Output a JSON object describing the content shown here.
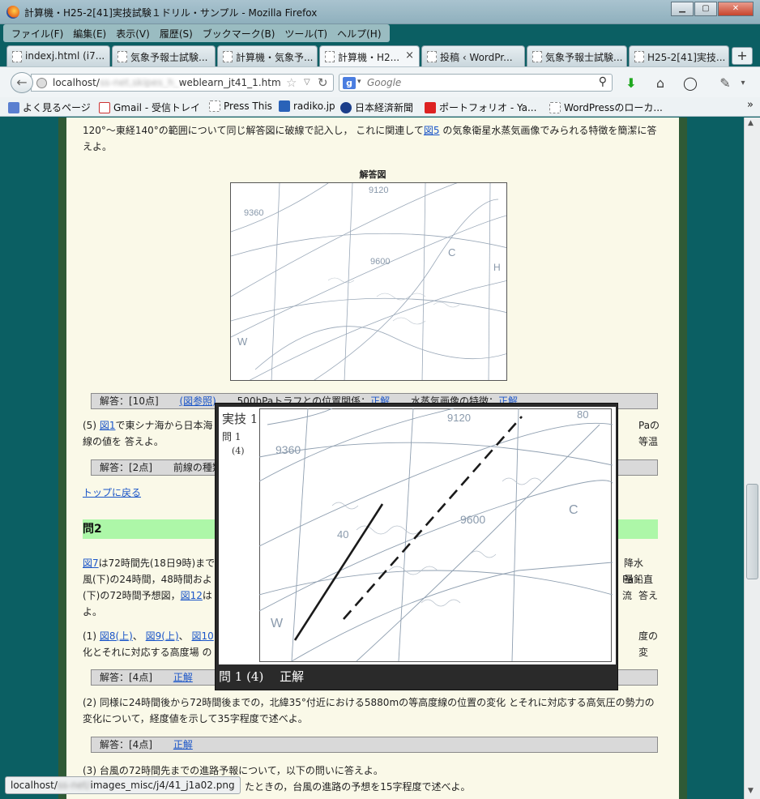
{
  "window": {
    "title": "計算機・H25-2[41]実技試験１ドリル・サンプル - Mozilla Firefox",
    "min": "▁",
    "max": "▢",
    "close": "✕"
  },
  "menu": [
    "ファイル(F)",
    "編集(E)",
    "表示(V)",
    "履歴(S)",
    "ブックマーク(B)",
    "ツール(T)",
    "ヘルプ(H)"
  ],
  "tabs": [
    {
      "label": "indexj.html (i7..."
    },
    {
      "label": "気象予報士試験..."
    },
    {
      "label": "計算機・気象予..."
    },
    {
      "label": "計算機・H2..."
    },
    {
      "label": "投稿 ‹ WordPr..."
    },
    {
      "label": "気象予報士試験..."
    },
    {
      "label": "H25-2[41]実技..."
    }
  ],
  "nav": {
    "url_host": "localhost/",
    "url_blur": "ss-net,skipes_h_",
    "url_rest": "weblearn_jt41_1.htm",
    "search_placeholder": "Google"
  },
  "bookmarks": [
    "よく見るページ",
    "Gmail - 受信トレイ",
    "Press This",
    "radiko.jp",
    "日本経済新聞",
    "ポートフォリオ - Ya...",
    "WordPressのローカ..."
  ],
  "page": {
    "intro1a": "120°〜東経140°の範囲について同じ解答図に破線で記入し， これに関連して",
    "intro1_link": "図5",
    "intro1b": " の気象衛星水蒸気画像でみられる特徴を簡潔に答",
    "intro2": "えよ。",
    "answer_fig_caption": "解答図",
    "ans_row1": {
      "score": "解答：[10点]",
      "ref": "(図参照)",
      "item1": "500hPaトラフとの位置関係：",
      "link1": "正解",
      "item2": "水蒸気画像の特徴：",
      "link2": "正解"
    },
    "q5a": "(5) ",
    "q5_link": "図1",
    "q5b": "で東シナ海から日本海",
    "q5c": "Paの等温",
    "q5d": "線の値を 答えよ。",
    "ans_row2": {
      "score": "解答：[2点]",
      "item": "前線の種類"
    },
    "top_link": "トップに戻る",
    "q2_heading": "問2",
    "p2a_link": "図7",
    "p2a": "は72時間先(18日9時)まで",
    "p2a_r": "降水量・",
    "p2b": "風(下)の24時間，48時間およ",
    "p2b_r": "Pa鉛直流",
    "p2c": "(下)の72時間予想図，",
    "p2c_link": "図12",
    "p2c_m": "は",
    "p2c_r": "答え",
    "p2d": "よ。",
    "q1a": "(1) ",
    "q1_link1": "図8(上)",
    "q1_sep1": "、",
    "q1_link2": "図9(上)",
    "q1_sep2": "、",
    "q1_link3": "図10",
    "q1_r": "度の変",
    "q1b": "化とそれに対応する高度場 の",
    "ans_row3": {
      "score": "解答：[4点]",
      "link": "正解"
    },
    "q2a": "(2) 同様に24時間後から72時間後までの，北緯35°付近における5880mの等高度線の位置の変化 とそれに対応する高気圧の勢力の",
    "q2b": "変化について，経度値を示して35字程度で述べよ。",
    "ans_row4": {
      "score": "解答：[4点]",
      "link": "正解"
    },
    "q3a": "(3) 台風の72時間先までの進路予報について，以下の問いに答えよ。",
    "q3b": "たときの，台風の進路の予想を15字程度で述べよ。"
  },
  "map_labels": {
    "h9120": "9120",
    "h9360": "9360",
    "h9600": "9600",
    "c": "C",
    "h": "H",
    "w": "W"
  },
  "overlay": {
    "side_title": "実技 1",
    "side_q": "問 1",
    "side_sub": "(4)",
    "caption": "問 1 (4)　 正解",
    "labels": {
      "h9120": "9120",
      "h9360": "9360",
      "h9600": "9600",
      "c": "C",
      "w": "W",
      "h80": "80",
      "h40": "40"
    }
  },
  "status": {
    "host": "localhost/",
    "blur": "ss-net/",
    "path": "images_misc/j4/41_j1a02.png"
  }
}
